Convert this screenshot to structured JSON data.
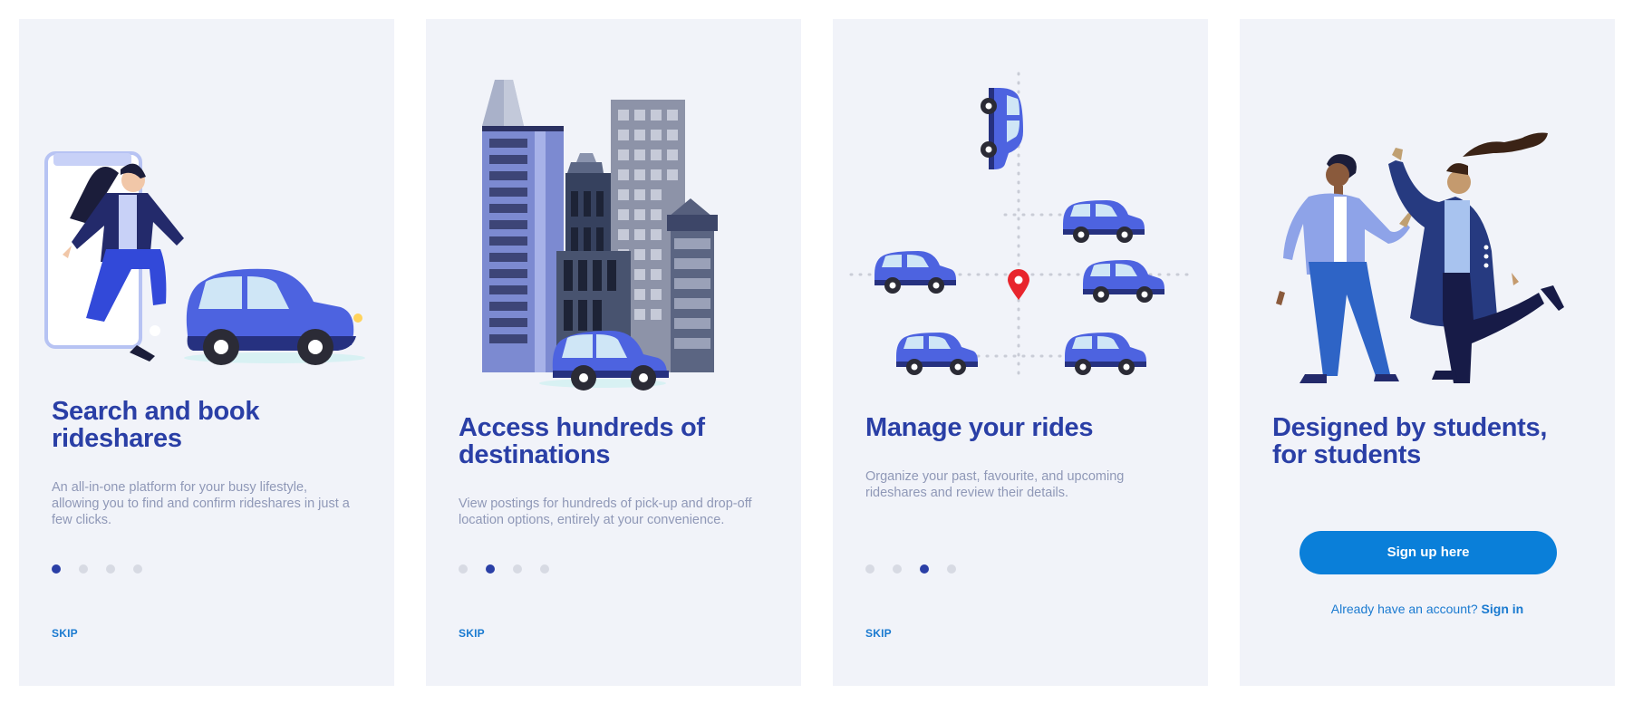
{
  "screens": [
    {
      "title": "Search and book rideshares",
      "title_lines": [
        "Search and book",
        "rideshares"
      ],
      "description": "An all-in-one platform for your busy lifestyle, allowing you to find and confirm rideshares in just a few clicks.",
      "active_dot": 1,
      "skip_label": "SKIP"
    },
    {
      "title": "Access hundreds of destinations",
      "title_lines": [
        "Access hundreds of",
        "destinations"
      ],
      "description": "View postings for hundreds of pick-up and drop-off location options, entirely at your convenience.",
      "active_dot": 2,
      "skip_label": "SKIP"
    },
    {
      "title": "Manage your rides",
      "title_lines": [
        "Manage your rides"
      ],
      "description": "Organize your past, favourite, and upcoming rideshares and review their details.",
      "active_dot": 3,
      "skip_label": "SKIP"
    },
    {
      "title": "Designed by students, for students",
      "title_lines": [
        "Designed by students,",
        "for students"
      ],
      "signup_label": "Sign up here",
      "account_prompt": "Already have an account?",
      "signin_label": "Sign in"
    }
  ],
  "pagination_total": 4,
  "colors": {
    "title": "#2a3fa6",
    "accent": "#0a7fd9",
    "link": "#1a7ad0",
    "card_background": "#f1f3f9",
    "dot_inactive": "#d7dae3"
  },
  "icons": [
    "phone-illustration",
    "woman-running-illustration",
    "car-illustration",
    "city-buildings-illustration",
    "map-pin-icon",
    "people-high-five-illustration"
  ]
}
